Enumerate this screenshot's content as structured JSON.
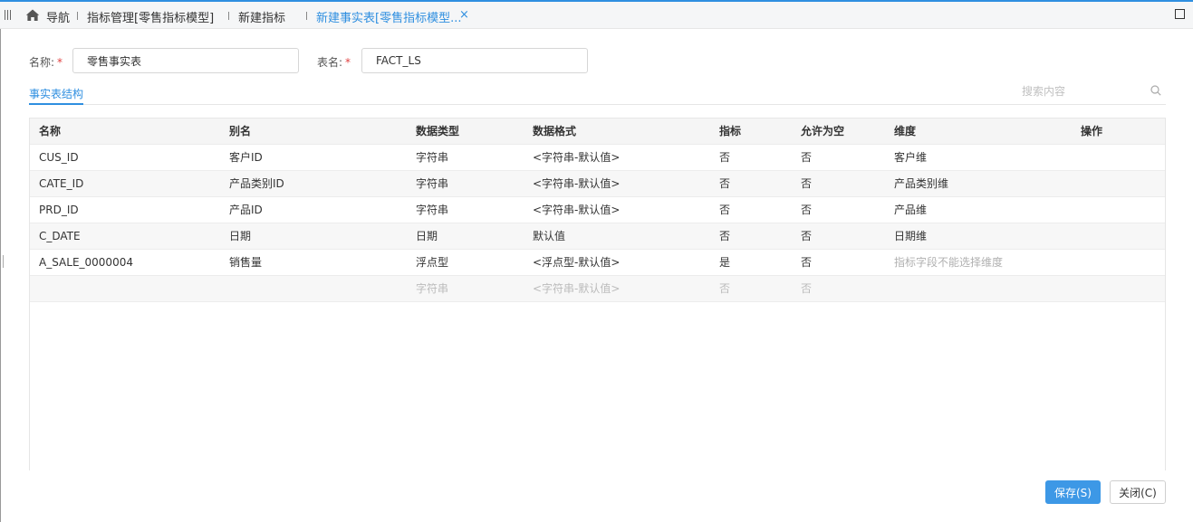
{
  "tabs": {
    "home_label": "导航",
    "items": [
      {
        "label": "指标管理[零售指标模型]"
      },
      {
        "label": "新建指标"
      },
      {
        "label": "新建事实表[零售指标模型..."
      }
    ],
    "close_glyph": "×"
  },
  "form": {
    "name_label": "名称:",
    "name_value": "零售事实表",
    "table_label": "表名:",
    "table_value": "FACT_LS",
    "required_mark": "*"
  },
  "section": {
    "tab_label": "事实表结构",
    "search_placeholder": "搜索内容"
  },
  "table": {
    "columns": [
      "名称",
      "别名",
      "数据类型",
      "数据格式",
      "指标",
      "允许为空",
      "维度",
      "操作"
    ],
    "rows": [
      {
        "name": "CUS_ID",
        "alias": "客户ID",
        "type": "字符串",
        "format": "<字符串-默认值>",
        "metric": "否",
        "nullable": "否",
        "dimension": "客户维"
      },
      {
        "name": "CATE_ID",
        "alias": "产品类别ID",
        "type": "字符串",
        "format": "<字符串-默认值>",
        "metric": "否",
        "nullable": "否",
        "dimension": "产品类别维"
      },
      {
        "name": "PRD_ID",
        "alias": "产品ID",
        "type": "字符串",
        "format": "<字符串-默认值>",
        "metric": "否",
        "nullable": "否",
        "dimension": "产品维"
      },
      {
        "name": "C_DATE",
        "alias": "日期",
        "type": "日期",
        "format": "默认值",
        "metric": "否",
        "nullable": "否",
        "dimension": "日期维"
      },
      {
        "name": "A_SALE_0000004",
        "alias": "销售量",
        "type": "浮点型",
        "format": "<浮点型-默认值>",
        "metric": "是",
        "nullable": "否",
        "dimension": "指标字段不能选择维度"
      }
    ],
    "new_row": {
      "type": "字符串",
      "format": "<字符串-默认值>",
      "metric": "否",
      "nullable": "否"
    }
  },
  "footer": {
    "save_label": "保存(S)",
    "close_label": "关闭(C)"
  },
  "colors": {
    "accent": "#2f8fe0",
    "required": "#e04040"
  }
}
